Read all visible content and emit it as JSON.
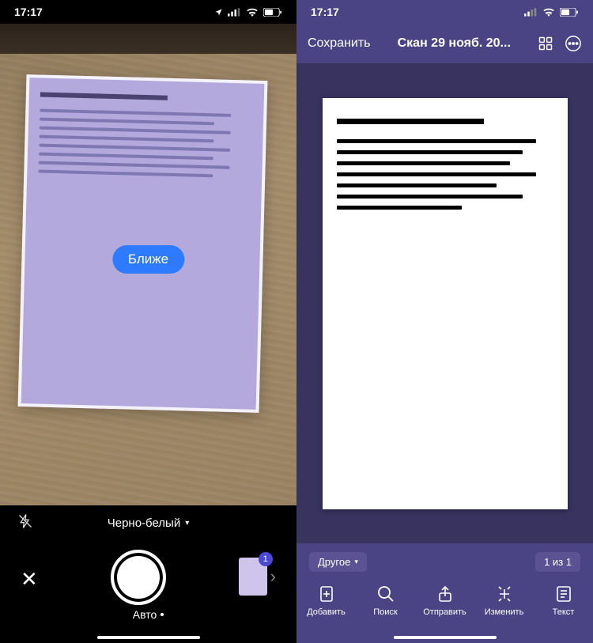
{
  "left": {
    "status_time": "17:17",
    "hint_label": "Ближе",
    "filter_label": "Черно-белый",
    "capture_mode": "Авто",
    "thumb_count": "1"
  },
  "right": {
    "status_time": "17:17",
    "header": {
      "save_label": "Сохранить",
      "title": "Скан 29 нояб. 20..."
    },
    "tag_label": "Другое",
    "pager_label": "1 из 1",
    "toolbar": {
      "add": "Добавить",
      "search": "Поиск",
      "send": "Отправить",
      "edit": "Изменить",
      "text": "Текст"
    }
  }
}
